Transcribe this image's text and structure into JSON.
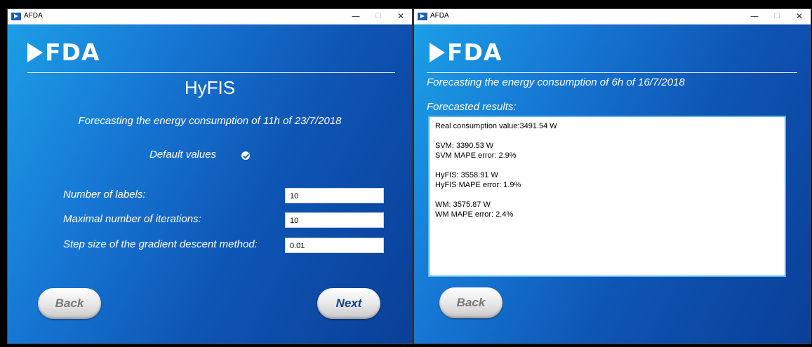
{
  "left_window": {
    "title": "AFDA",
    "controls": {
      "minimize": "—",
      "maximize": "☐",
      "close": "✕"
    },
    "logo_text": "FDA",
    "heading": "HyFIS",
    "subtitle": "Forecasting the energy consumption of 11h of 23/7/2018",
    "default_values_label": "Default values",
    "default_values_checked": true,
    "fields": [
      {
        "label": "Number of labels:",
        "value": "10"
      },
      {
        "label": "Maximal number of iterations:",
        "value": "10"
      },
      {
        "label": "Step size of the gradient descent method:",
        "value": "0.01"
      }
    ],
    "back_label": "Back",
    "next_label": "Next"
  },
  "right_window": {
    "title": "AFDA",
    "controls": {
      "minimize": "—",
      "maximize": "☐",
      "close": "✕"
    },
    "logo_text": "FDA",
    "subtitle": "Forecasting the energy consumption of 6h of 16/7/2018",
    "results_label": "Forecasted results:",
    "results": {
      "real": "Real consumption value:3491.54 W",
      "svm": "SVM: 3390.53 W",
      "svm_error": "SVM MAPE error: 2.9%",
      "hyfis": "HyFIS: 3558.91 W",
      "hyfis_error": "HyFIS MAPE error: 1.9%",
      "wm": "WM: 3575.87 W",
      "wm_error": "WM MAPE error: 2.4%"
    },
    "back_label": "Back"
  },
  "colors": {
    "accent_light": "#1c9fe6",
    "accent_dark": "#0a3f98",
    "results_border": "#5ab7ee",
    "next_text": "#113e8f"
  }
}
